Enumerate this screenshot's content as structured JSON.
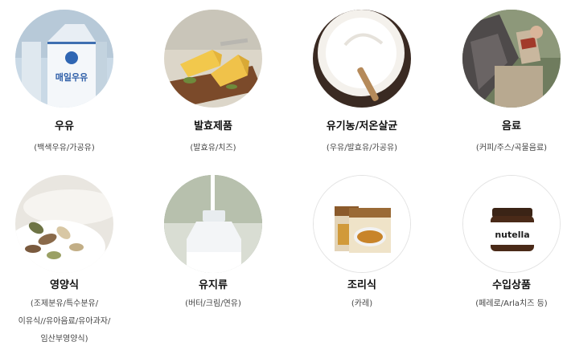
{
  "categories": [
    {
      "title": "우유",
      "sub": [
        "(백색우유/가공유)"
      ],
      "carton_text": "매일우유"
    },
    {
      "title": "발효제품",
      "sub": [
        "(발효유/치즈)"
      ]
    },
    {
      "title": "유기농/저온살균",
      "sub": [
        "(우유/발효유/가공유)"
      ]
    },
    {
      "title": "음료",
      "sub": [
        "(커피/주스/곡물음료)"
      ]
    },
    {
      "title": "영양식",
      "sub": [
        "(조제분유/특수분유/",
        "이유식//유아음료/유아과자/",
        "임산부영양식)"
      ]
    },
    {
      "title": "유지류",
      "sub": [
        "(버터/크림/연유)"
      ]
    },
    {
      "title": "조리식",
      "sub": [
        "(카레)"
      ]
    },
    {
      "title": "수입상품",
      "sub": [
        "(페레로/Arla치즈 등)"
      ],
      "jar_text": "nutella"
    }
  ]
}
